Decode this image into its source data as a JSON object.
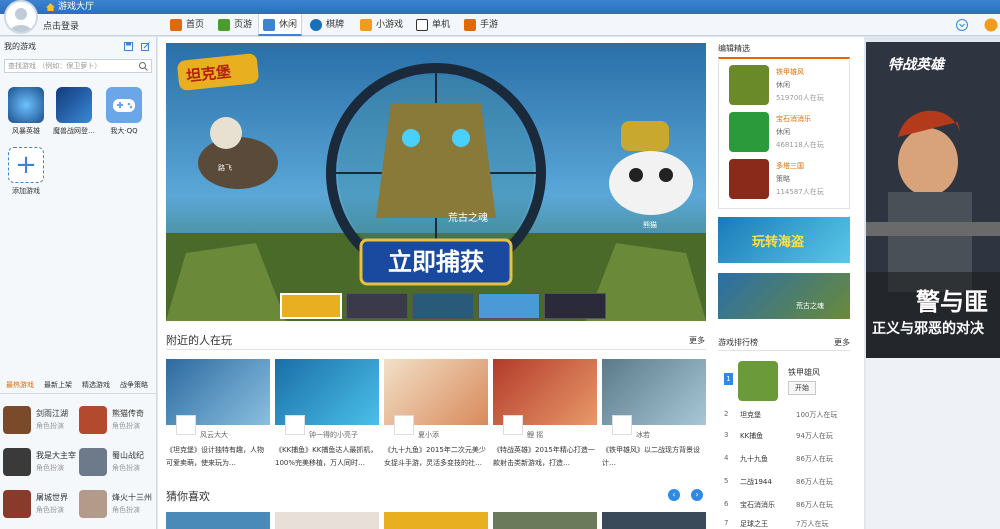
{
  "window": {
    "title": "游戏大厅"
  },
  "user": {
    "login_label": "点击登录"
  },
  "nav": {
    "tabs": [
      {
        "label": "首页",
        "icon": "home-icon",
        "color": "#e16a06"
      },
      {
        "label": "页游",
        "icon": "page-game-icon",
        "color": "#4a9c2e"
      },
      {
        "label": "休闲",
        "icon": "casual-icon",
        "color": "#3c83d1"
      },
      {
        "label": "棋牌",
        "icon": "cards-icon",
        "color": "#1a6fb8"
      },
      {
        "label": "小游戏",
        "icon": "mini-game-icon",
        "color": "#f29b1d"
      },
      {
        "label": "单机",
        "icon": "single-icon",
        "color": "#333333"
      },
      {
        "label": "手游",
        "icon": "mobile-game-icon",
        "color": "#e16a06"
      }
    ],
    "active_tab": "休闲"
  },
  "sidebar": {
    "heading": "我的游戏",
    "search_placeholder": "查找游戏 （例如：保卫萝卜）",
    "games": [
      {
        "label": "风暴英雄",
        "color": "#2a6fae"
      },
      {
        "label": "魔兽战网登…",
        "color": "#123a7a"
      },
      {
        "label": "我大·QQ",
        "color": "#6aa6e8"
      }
    ],
    "add_label": "添加游戏",
    "tabs": [
      "最热游戏",
      "最新上架",
      "精选游戏",
      "战争策略"
    ],
    "recommended": [
      {
        "name": "剑雨江湖",
        "type": "角色扮演",
        "color": "#7a4a2a"
      },
      {
        "name": "熊猫传奇",
        "type": "角色扮演",
        "color": "#b34a2e"
      },
      {
        "name": "我是大主宰",
        "type": "角色扮演",
        "color": "#3a3a3a"
      },
      {
        "name": "蜀山战纪",
        "type": "角色扮演",
        "color": "#6c7a8a"
      },
      {
        "name": "屠城世界",
        "type": "角色扮演",
        "color": "#8a3a2a"
      },
      {
        "name": "烽火十三州",
        "type": "角色扮演",
        "color": "#b39a8a"
      }
    ]
  },
  "banner": {
    "logo_text": "坦克堡",
    "cta": "立即捕获",
    "caption": "荒古之魂",
    "left_label": "路飞",
    "right_label": "熊猫"
  },
  "nearby": {
    "title": "附近的人在玩",
    "more_label": "更多",
    "cards": [
      {
        "user": "风云大大",
        "desc": "《坦克堡》设计独特有趣，人物可爱卖萌，使来玩为…",
        "color": "#2d6aa0"
      },
      {
        "user": "钟一得的小亮子",
        "desc": "《KK捕鱼》KK捕鱼达人最抓机，100%完美移植，万人同时…",
        "color": "#1a6ea8"
      },
      {
        "user": "夏小添",
        "desc": "《九十九鱼》2015年二次元美少女捉斗手游，灵活多变技的社…",
        "color": "#e8c9a8"
      },
      {
        "user": "鲤 摇",
        "desc": "《特战英雄》2015年精心打造一款射击类新游戏，打造…",
        "color": "#b33a2a"
      },
      {
        "user": "冰若",
        "desc": "《铁甲雄风》以二战现方背景设计…",
        "color": "#5a7a8a"
      }
    ]
  },
  "guess": {
    "title": "猜你喜欢",
    "prev_icon": "chevron-left-icon",
    "next_icon": "chevron-right-icon"
  },
  "editor_picks": {
    "title": "编辑精选",
    "items": [
      {
        "name": "铁甲雄风",
        "type": "休闲",
        "players": "519700人在玩",
        "color": "#6a8a2a"
      },
      {
        "name": "宝石消消乐",
        "type": "休闲",
        "players": "468118人在玩",
        "color": "#2a9a3a"
      },
      {
        "name": "多塔三国",
        "type": "策略",
        "players": "114587人在玩",
        "color": "#8a2a1a"
      }
    ]
  },
  "promos": [
    {
      "label": "玩转海盗"
    },
    {
      "label": "荒古之魂"
    }
  ],
  "ranking": {
    "title": "游戏排行榜",
    "more_label": "更多",
    "first": {
      "rank": "1",
      "name": "铁甲雄风",
      "button": "开始"
    },
    "rows": [
      {
        "rank": "2",
        "name": "坦克堡",
        "players": "100万人在玩"
      },
      {
        "rank": "3",
        "name": "KK捕鱼",
        "players": "94万人在玩"
      },
      {
        "rank": "4",
        "name": "九十九鱼",
        "players": "86万人在玩"
      },
      {
        "rank": "5",
        "name": "二战1944",
        "players": "86万人在玩"
      },
      {
        "rank": "6",
        "name": "宝石消消乐",
        "players": "86万人在玩"
      },
      {
        "rank": "7",
        "name": "足球之王",
        "players": "7万人在玩"
      }
    ]
  },
  "right_ad": {
    "title": "特战英雄",
    "slogan": "警与匪",
    "subtitle": "正义与邪恶的对决"
  },
  "colors": {
    "accent": "#3c83d1",
    "orange": "#e16a06",
    "link_blue": "#2e8ae6"
  }
}
